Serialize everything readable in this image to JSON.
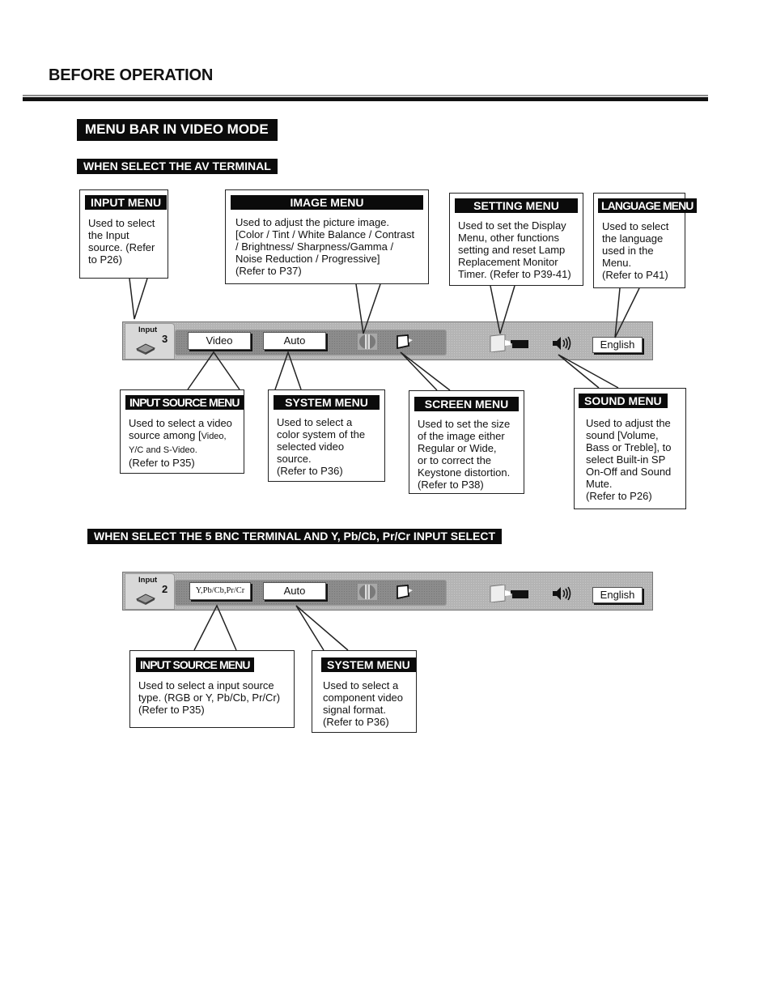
{
  "page": {
    "title": "BEFORE OPERATION",
    "section_title": "MENU BAR IN VIDEO MODE"
  },
  "av_terminal": {
    "subtitle": "WHEN SELECT THE AV TERMINAL",
    "menubar": {
      "input_tab_label": "Input",
      "input_number": "3",
      "input_source_value": "Video",
      "system_value": "Auto",
      "language_value": "English",
      "icons": [
        "input-icon",
        "image-menu-icon",
        "screen-menu-icon",
        "setting-menu-icon",
        "sound-icon"
      ]
    },
    "callouts_top": [
      {
        "title": "INPUT MENU",
        "body": "Used to select\nthe Input\nsource. (Refer\nto P26)"
      },
      {
        "title": "IMAGE MENU",
        "body": "Used to adjust the picture image.\n[Color / Tint / White Balance / Contrast\n/ Brightness/ Sharpness/Gamma /\nNoise  Reduction / Progressive]\n(Refer to P37)"
      },
      {
        "title": "SETTING MENU",
        "body": "Used to set the Display\nMenu, other functions\nsetting and reset Lamp\nReplacement Monitor\nTimer. (Refer to P39-41)"
      },
      {
        "title": "LANGUAGE MENU",
        "body": "Used to select\nthe language\nused in the\nMenu.\n(Refer to P41)"
      }
    ],
    "callouts_bottom": [
      {
        "title": "INPUT SOURCE MENU",
        "body_line1": "Used to select a video\nsource among [",
        "body_small": "Video,\nY/C and S-Video.",
        "body_line3": "\n(Refer to P35)"
      },
      {
        "title": "SYSTEM MENU",
        "body": "Used to select a\ncolor system of the\nselected video\nsource.\n(Refer to P36)"
      },
      {
        "title": "SCREEN MENU",
        "body": "Used to set the size\nof the image either\nRegular or  Wide,\nor to correct the\nKeystone distortion.\n(Refer to P38)"
      },
      {
        "title": "SOUND MENU",
        "body": "Used to adjust the\nsound [Volume,\nBass or Treble], to\nselect Built-in SP\nOn-Off and Sound\nMute.\n(Refer to P26)"
      }
    ]
  },
  "bnc_terminal": {
    "subtitle": "WHEN SELECT THE 5 BNC TERMINAL AND Y, Pb/Cb, Pr/Cr INPUT SELECT",
    "menubar": {
      "input_tab_label": "Input",
      "input_number": "2",
      "input_source_value": "Y,Pb/Cb,Pr/Cr",
      "system_value": "Auto",
      "language_value": "English"
    },
    "callouts_bottom": [
      {
        "title": "INPUT SOURCE MENU",
        "body": "Used to select a input source\ntype. (RGB or Y, Pb/Cb, Pr/Cr)\n(Refer to P35)"
      },
      {
        "title": "SYSTEM MENU",
        "body": "Used to select a\ncomponent video\nsignal format.\n(Refer to P36)"
      }
    ]
  }
}
